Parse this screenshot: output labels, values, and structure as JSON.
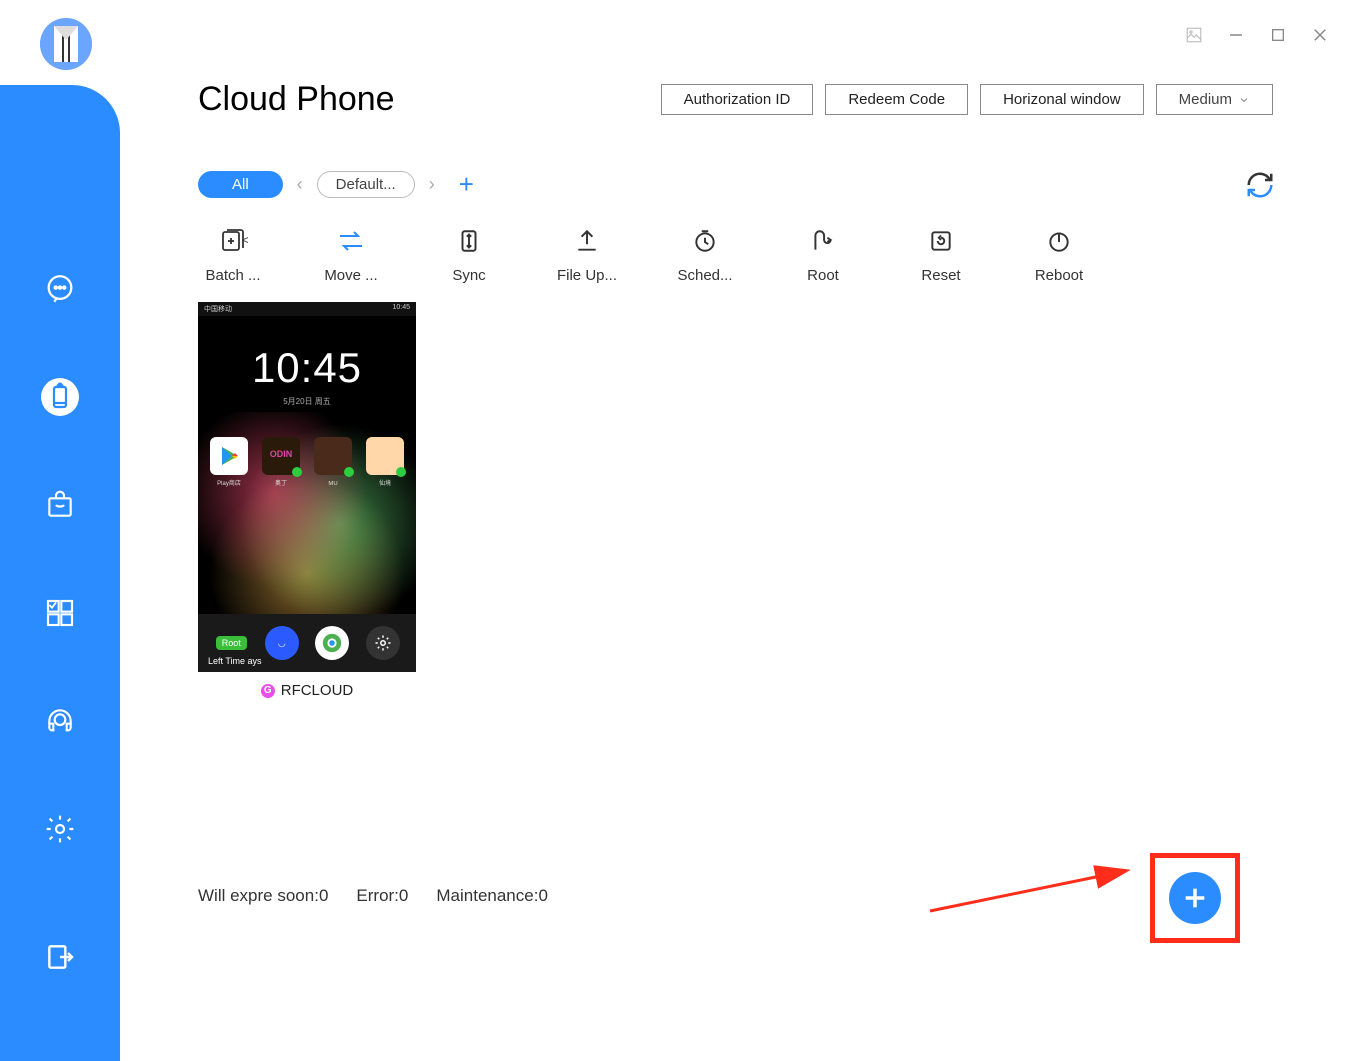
{
  "page_title": "Cloud Phone",
  "header_buttons": {
    "auth_id": "Authorization ID",
    "redeem": "Redeem Code",
    "horizontal": "Horizonal window",
    "size": "Medium"
  },
  "filters": {
    "all": "All",
    "default": "Default..."
  },
  "toolbar": {
    "batch": "Batch ...",
    "move": "Move ...",
    "sync": "Sync",
    "file_upload": "File Up...",
    "schedule": "Sched...",
    "root": "Root",
    "reset": "Reset",
    "reboot": "Reboot"
  },
  "device": {
    "name": "RFCLOUD",
    "clock": "10:45",
    "clock_sub": "5月20日   周五",
    "status_left": "中国移动",
    "status_right": "10:45",
    "root_badge": "Root",
    "left_time": "Left Time   ays",
    "badge_letter": "G"
  },
  "footer": {
    "expire_label": "Will expre soon:",
    "expire_value": "0",
    "error_label": "Error:",
    "error_value": "0",
    "maintenance_label": "Maintenance:",
    "maintenance_value": "0"
  }
}
